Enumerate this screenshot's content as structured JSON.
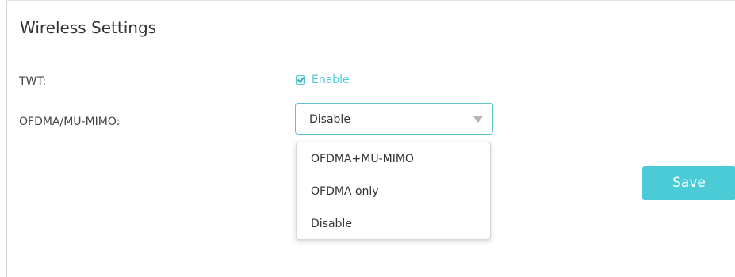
{
  "section": {
    "title": "Wireless Settings"
  },
  "fields": {
    "twt": {
      "label": "TWT:",
      "checkbox_label": "Enable",
      "checked": true
    },
    "ofdma": {
      "label": "OFDMA/MU-MIMO:",
      "selected": "Disable",
      "options": [
        "OFDMA+MU-MIMO",
        "OFDMA only",
        "Disable"
      ]
    }
  },
  "actions": {
    "save_label": "Save"
  },
  "colors": {
    "accent": "#4acbd6",
    "text": "#333333",
    "border": "#d6d6d6"
  },
  "icons": {
    "checkbox": "checkbox-checked-icon",
    "dropdown_arrow": "caret-down-icon"
  }
}
